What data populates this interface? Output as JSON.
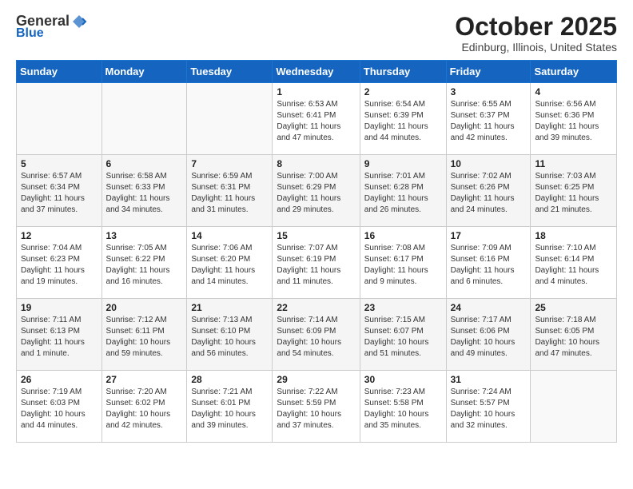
{
  "header": {
    "logo_general": "General",
    "logo_blue": "Blue",
    "month_title": "October 2025",
    "location": "Edinburg, Illinois, United States"
  },
  "days_of_week": [
    "Sunday",
    "Monday",
    "Tuesday",
    "Wednesday",
    "Thursday",
    "Friday",
    "Saturday"
  ],
  "weeks": [
    [
      {
        "day": "",
        "info": ""
      },
      {
        "day": "",
        "info": ""
      },
      {
        "day": "",
        "info": ""
      },
      {
        "day": "1",
        "info": "Sunrise: 6:53 AM\nSunset: 6:41 PM\nDaylight: 11 hours\nand 47 minutes."
      },
      {
        "day": "2",
        "info": "Sunrise: 6:54 AM\nSunset: 6:39 PM\nDaylight: 11 hours\nand 44 minutes."
      },
      {
        "day": "3",
        "info": "Sunrise: 6:55 AM\nSunset: 6:37 PM\nDaylight: 11 hours\nand 42 minutes."
      },
      {
        "day": "4",
        "info": "Sunrise: 6:56 AM\nSunset: 6:36 PM\nDaylight: 11 hours\nand 39 minutes."
      }
    ],
    [
      {
        "day": "5",
        "info": "Sunrise: 6:57 AM\nSunset: 6:34 PM\nDaylight: 11 hours\nand 37 minutes."
      },
      {
        "day": "6",
        "info": "Sunrise: 6:58 AM\nSunset: 6:33 PM\nDaylight: 11 hours\nand 34 minutes."
      },
      {
        "day": "7",
        "info": "Sunrise: 6:59 AM\nSunset: 6:31 PM\nDaylight: 11 hours\nand 31 minutes."
      },
      {
        "day": "8",
        "info": "Sunrise: 7:00 AM\nSunset: 6:29 PM\nDaylight: 11 hours\nand 29 minutes."
      },
      {
        "day": "9",
        "info": "Sunrise: 7:01 AM\nSunset: 6:28 PM\nDaylight: 11 hours\nand 26 minutes."
      },
      {
        "day": "10",
        "info": "Sunrise: 7:02 AM\nSunset: 6:26 PM\nDaylight: 11 hours\nand 24 minutes."
      },
      {
        "day": "11",
        "info": "Sunrise: 7:03 AM\nSunset: 6:25 PM\nDaylight: 11 hours\nand 21 minutes."
      }
    ],
    [
      {
        "day": "12",
        "info": "Sunrise: 7:04 AM\nSunset: 6:23 PM\nDaylight: 11 hours\nand 19 minutes."
      },
      {
        "day": "13",
        "info": "Sunrise: 7:05 AM\nSunset: 6:22 PM\nDaylight: 11 hours\nand 16 minutes."
      },
      {
        "day": "14",
        "info": "Sunrise: 7:06 AM\nSunset: 6:20 PM\nDaylight: 11 hours\nand 14 minutes."
      },
      {
        "day": "15",
        "info": "Sunrise: 7:07 AM\nSunset: 6:19 PM\nDaylight: 11 hours\nand 11 minutes."
      },
      {
        "day": "16",
        "info": "Sunrise: 7:08 AM\nSunset: 6:17 PM\nDaylight: 11 hours\nand 9 minutes."
      },
      {
        "day": "17",
        "info": "Sunrise: 7:09 AM\nSunset: 6:16 PM\nDaylight: 11 hours\nand 6 minutes."
      },
      {
        "day": "18",
        "info": "Sunrise: 7:10 AM\nSunset: 6:14 PM\nDaylight: 11 hours\nand 4 minutes."
      }
    ],
    [
      {
        "day": "19",
        "info": "Sunrise: 7:11 AM\nSunset: 6:13 PM\nDaylight: 11 hours\nand 1 minute."
      },
      {
        "day": "20",
        "info": "Sunrise: 7:12 AM\nSunset: 6:11 PM\nDaylight: 10 hours\nand 59 minutes."
      },
      {
        "day": "21",
        "info": "Sunrise: 7:13 AM\nSunset: 6:10 PM\nDaylight: 10 hours\nand 56 minutes."
      },
      {
        "day": "22",
        "info": "Sunrise: 7:14 AM\nSunset: 6:09 PM\nDaylight: 10 hours\nand 54 minutes."
      },
      {
        "day": "23",
        "info": "Sunrise: 7:15 AM\nSunset: 6:07 PM\nDaylight: 10 hours\nand 51 minutes."
      },
      {
        "day": "24",
        "info": "Sunrise: 7:17 AM\nSunset: 6:06 PM\nDaylight: 10 hours\nand 49 minutes."
      },
      {
        "day": "25",
        "info": "Sunrise: 7:18 AM\nSunset: 6:05 PM\nDaylight: 10 hours\nand 47 minutes."
      }
    ],
    [
      {
        "day": "26",
        "info": "Sunrise: 7:19 AM\nSunset: 6:03 PM\nDaylight: 10 hours\nand 44 minutes."
      },
      {
        "day": "27",
        "info": "Sunrise: 7:20 AM\nSunset: 6:02 PM\nDaylight: 10 hours\nand 42 minutes."
      },
      {
        "day": "28",
        "info": "Sunrise: 7:21 AM\nSunset: 6:01 PM\nDaylight: 10 hours\nand 39 minutes."
      },
      {
        "day": "29",
        "info": "Sunrise: 7:22 AM\nSunset: 5:59 PM\nDaylight: 10 hours\nand 37 minutes."
      },
      {
        "day": "30",
        "info": "Sunrise: 7:23 AM\nSunset: 5:58 PM\nDaylight: 10 hours\nand 35 minutes."
      },
      {
        "day": "31",
        "info": "Sunrise: 7:24 AM\nSunset: 5:57 PM\nDaylight: 10 hours\nand 32 minutes."
      },
      {
        "day": "",
        "info": ""
      }
    ]
  ]
}
